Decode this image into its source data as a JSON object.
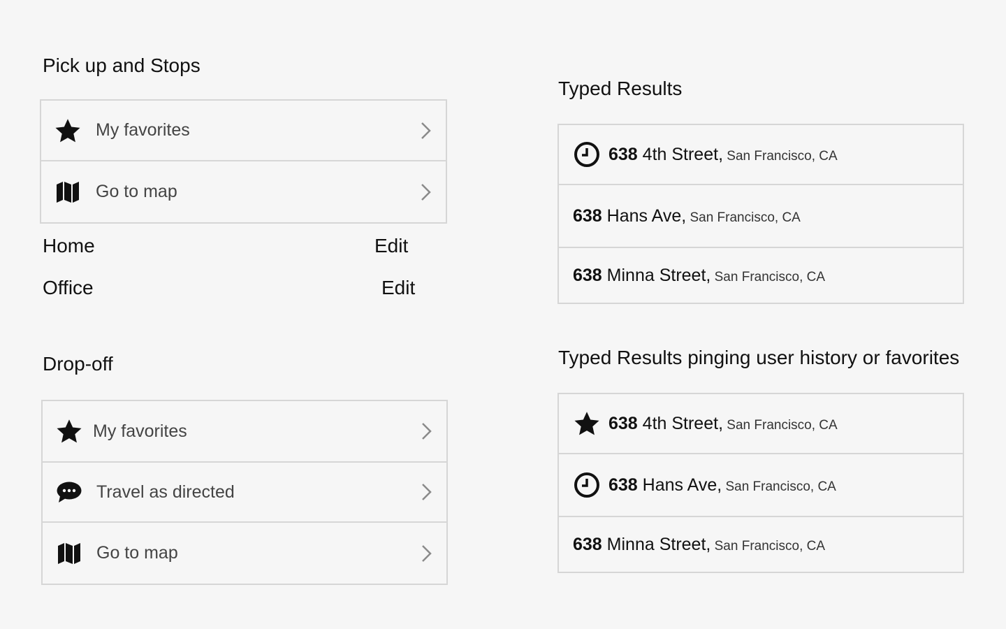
{
  "pickup": {
    "title": "Pick up and Stops",
    "items": [
      {
        "label": "My favorites",
        "icon": "star-icon"
      },
      {
        "label": "Go to map",
        "icon": "map-icon"
      }
    ],
    "places": [
      {
        "name": "Home",
        "action": "Edit"
      },
      {
        "name": "Office",
        "action": "Edit"
      }
    ]
  },
  "dropoff": {
    "title": "Drop-off",
    "items": [
      {
        "label": "My favorites",
        "icon": "star-icon"
      },
      {
        "label": "Travel as directed",
        "icon": "chat-bubble-icon"
      },
      {
        "label": "Go to map",
        "icon": "map-icon"
      }
    ]
  },
  "typed": {
    "title": "Typed Results",
    "results": [
      {
        "icon": "clock-icon",
        "number": "638",
        "street": " 4th Street,",
        "city": " San Francisco, CA"
      },
      {
        "icon": "",
        "number": "638",
        "street": " Hans Ave,",
        "city": " San Francisco, CA"
      },
      {
        "icon": "",
        "number": "638",
        "street": " Minna Street,",
        "city": " San Francisco, CA"
      }
    ]
  },
  "history": {
    "title": "Typed Results pinging user history or favorites",
    "results": [
      {
        "icon": "star-icon",
        "number": "638",
        "street": " 4th Street,",
        "city": " San Francisco, CA"
      },
      {
        "icon": "clock-icon",
        "number": "638",
        "street": " Hans Ave,",
        "city": " San Francisco, CA"
      },
      {
        "icon": "",
        "number": "638",
        "street": " Minna Street,",
        "city": " San Francisco, CA"
      }
    ]
  }
}
